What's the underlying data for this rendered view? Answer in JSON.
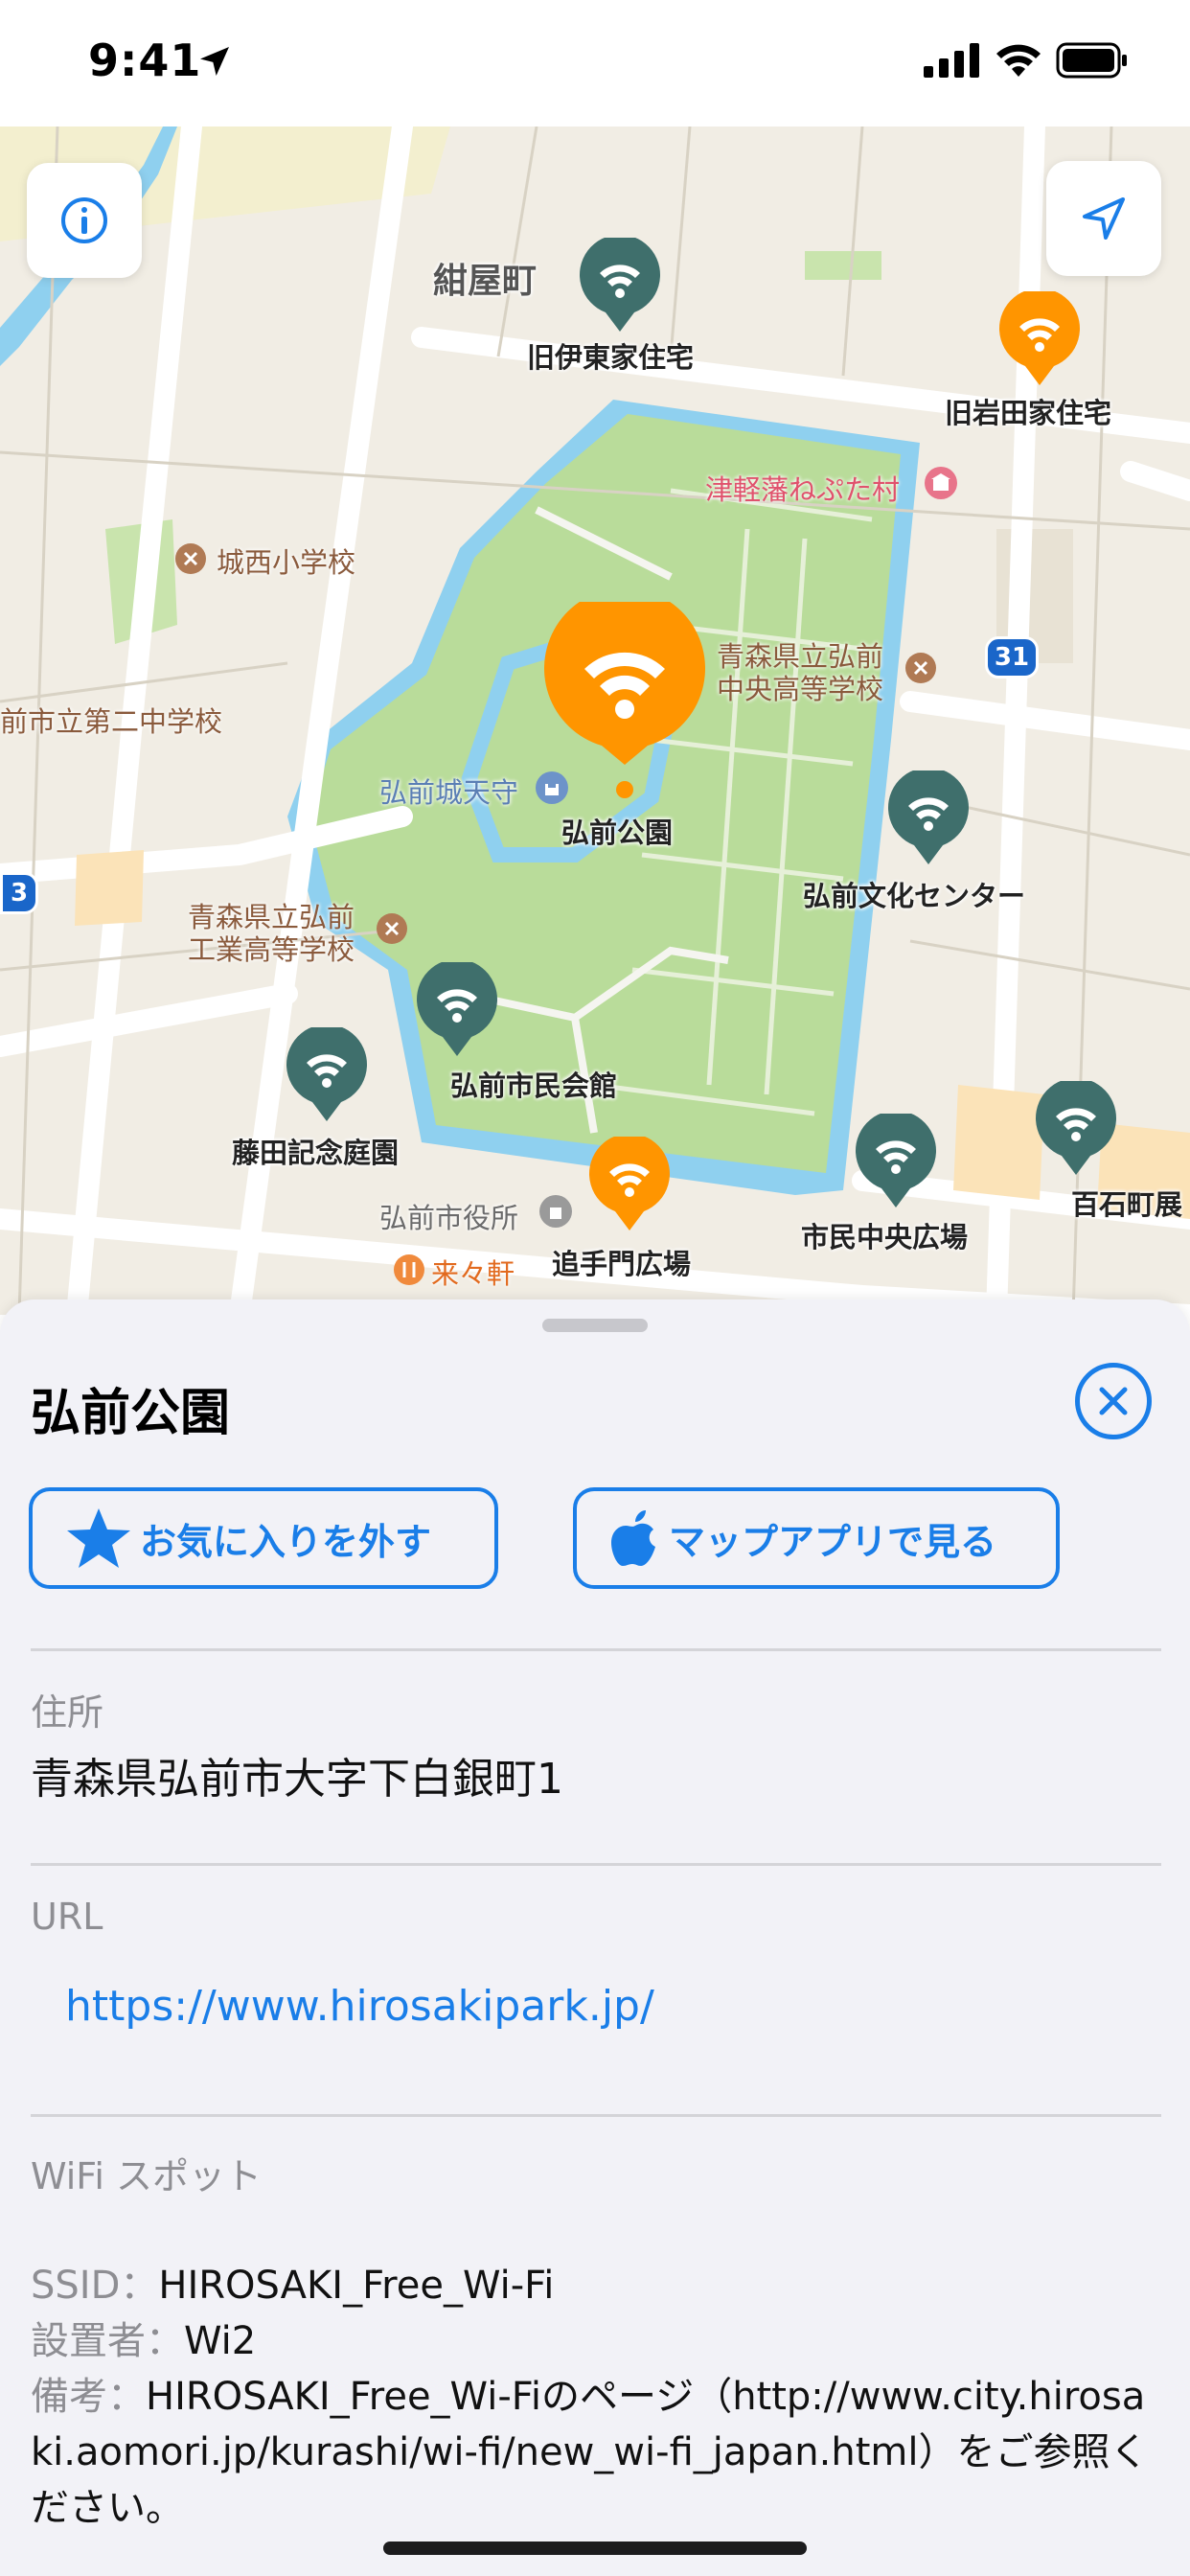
{
  "status_bar": {
    "time": "9:41"
  },
  "map": {
    "labels": [
      {
        "text": "紺屋町"
      },
      {
        "text": "旧伊東家住宅"
      },
      {
        "text": "旧岩田家住宅"
      },
      {
        "text": "津軽藩ねぷた村"
      },
      {
        "text": "城西小学校"
      },
      {
        "text": "青森県立弘前"
      },
      {
        "text": "中央高等学校"
      },
      {
        "text": "前市立第二中学校"
      },
      {
        "text": "弘前城天守"
      },
      {
        "text": "弘前公園"
      },
      {
        "text": "弘前文化センター"
      },
      {
        "text": "青森県立弘前"
      },
      {
        "text": "工業高等学校"
      },
      {
        "text": "弘前市民会館"
      },
      {
        "text": "藤田記念庭園"
      },
      {
        "text": "弘前市役所"
      },
      {
        "text": "追手門広場"
      },
      {
        "text": "市民中央広場"
      },
      {
        "text": "百石町展"
      },
      {
        "text": "来々軒"
      }
    ],
    "route_shields": [
      "31",
      "3"
    ],
    "colors": {
      "hotspot_orange": "#ff9500",
      "hotspot_teal": "#3f6f6c",
      "park_green": "#b9dc9a",
      "water_blue": "#8fd0ef"
    }
  },
  "sheet": {
    "title": "弘前公園",
    "favorite_button": "お気に入りを外す",
    "maps_button": "マップアプリで見る",
    "address_label": "住所",
    "address_value": "青森県弘前市大字下白銀町1",
    "url_label": "URL",
    "url_value": "https://www.hirosakipark.jp/",
    "wifi_label": "WiFi スポット",
    "ssid_key": "SSID：",
    "ssid_value": "HIROSAKI_Free_Wi-Fi",
    "installer_key": "設置者：",
    "installer_value": "Wi2",
    "note_key": "備考：",
    "note_value": "HIROSAKI_Free_Wi-Fiのページ（http://www.city.hirosaki.aomori.jp/kurashi/wi-fi/new_wi-fi_japan.html）をご参照ください。"
  }
}
